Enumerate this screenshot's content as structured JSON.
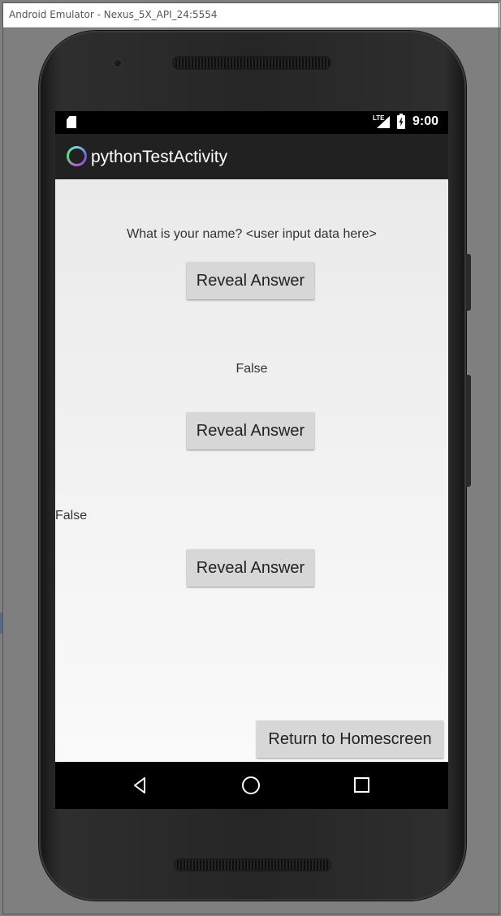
{
  "window": {
    "title": "Android Emulator - Nexus_5X_API_24:5554"
  },
  "status_bar": {
    "time": "9:00",
    "network": "LTE"
  },
  "action_bar": {
    "title": "pythonTestActivity"
  },
  "content": {
    "question1": "What is your name? <user input data here>",
    "reveal_button_1": "Reveal Answer",
    "answer1": "False",
    "reveal_button_2": "Reveal Answer",
    "answer2": "False",
    "reveal_button_3": "Reveal Answer",
    "return_button": "Return to Homescreen"
  },
  "colors": {
    "action_bar": "#212121",
    "button": "#d7d7d7",
    "content_bg": "#f0f0f0"
  }
}
